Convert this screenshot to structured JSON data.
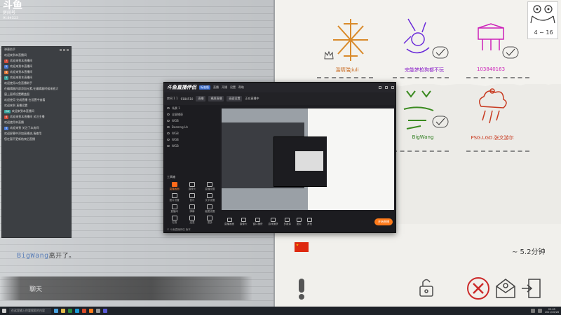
{
  "logo": {
    "big": "斗鱼",
    "line1": "房间号",
    "line2": "9184523"
  },
  "chat": {
    "header": "弹幕助手",
    "lines": [
      {
        "tag": "",
        "tagColor": "",
        "text": "欢迎来到本直播间"
      },
      {
        "tag": "7",
        "tagColor": "t-red",
        "text": "欢迎来到本直播间"
      },
      {
        "tag": "5",
        "tagColor": "t-blue",
        "text": "欢迎来到本直播间"
      },
      {
        "tag": "8",
        "tagColor": "t-orange",
        "text": "欢迎来到本直播间"
      },
      {
        "tag": "3",
        "tagColor": "t-teal",
        "text": "欢迎来到本直播间"
      },
      {
        "tag": "",
        "tagColor": "",
        "text": "欢迎使用斗鱼直播助手"
      },
      {
        "tag": "",
        "tagColor": "",
        "text": "在编辑器内部添加元素,在编辑器时候来放大"
      },
      {
        "tag": "",
        "tagColor": "",
        "text": "窗上面将设置覆盖图"
      },
      {
        "tag": "",
        "tagColor": "",
        "text": "欢迎使用 完成直播 在设置中查看"
      },
      {
        "tag": "",
        "tagColor": "",
        "text": "欢迎来到 直播设置"
      },
      {
        "tag": "CA",
        "tagColor": "t-teal",
        "text": "欢迎来到本直播间"
      },
      {
        "tag": "6",
        "tagColor": "t-red",
        "text": "欢迎来到本直播间 关注主播"
      },
      {
        "tag": "",
        "tagColor": "",
        "text": "欢迎使用本直播"
      },
      {
        "tag": "5",
        "tagColor": "t-blue",
        "text": "欢迎来到 关注了本房间"
      },
      {
        "tag": "",
        "tagColor": "",
        "text": "欢迎屏幕中添加直播流,请使用"
      },
      {
        "tag": "",
        "tagColor": "",
        "text": "您在暂不更新结束后直播"
      }
    ]
  },
  "status": {
    "user": "BigWang",
    "message": "离开了。"
  },
  "chat_input": {
    "placeholder": "聊天"
  },
  "signatures": [
    {
      "name": "溫晴瑞Jiuli",
      "color": "#c8691f"
    },
    {
      "name": "完能梦枪狗都不玩",
      "color": "#8a1fc8"
    },
    {
      "name": "103840163",
      "color": "#cc1fb8"
    },
    {
      "name": "BigWang",
      "color": "#2e7d1f"
    },
    {
      "name": "PSG.LGD.张文游尔",
      "color": "#c8391f"
    }
  ],
  "page_counter": "4 ∼ 16",
  "timer": "∼ 5.2分钟",
  "app": {
    "title": "斗鱼直播伴侣",
    "badge": "标准版",
    "menu": [
      "直播",
      "开播",
      "设置",
      "帮助"
    ],
    "toolbar": [
      "房间 1 1 ",
      "9184510",
      "直播",
      "横屏直播",
      "画面设置",
      "正在直播中"
    ],
    "scenes": [
      "场景 1",
      "全屏捕获",
      "WGB",
      "Beamng.Us",
      "WGB",
      "WGB",
      "WGB"
    ],
    "tools_label": "工具箱",
    "tools": [
      "直播画面",
      "摄像头",
      "直播设置",
      "图片设置",
      "音乐",
      "文字设置",
      "直播间",
      "弹幕",
      "截图设置",
      "礼物",
      "连麦",
      "更多"
    ],
    "bottom_tools": [
      "直播画面",
      "摄像头",
      "窗口捕获",
      "游戏捕获",
      "多媒体",
      "图片",
      "其他"
    ],
    "start_button": "开始直播",
    "footer": "© 斗鱼直播伴侣 版本"
  },
  "taskbar": {
    "search": "在这里输入你要搜索的内容",
    "time": "22:05",
    "date": "2021/10/28"
  }
}
